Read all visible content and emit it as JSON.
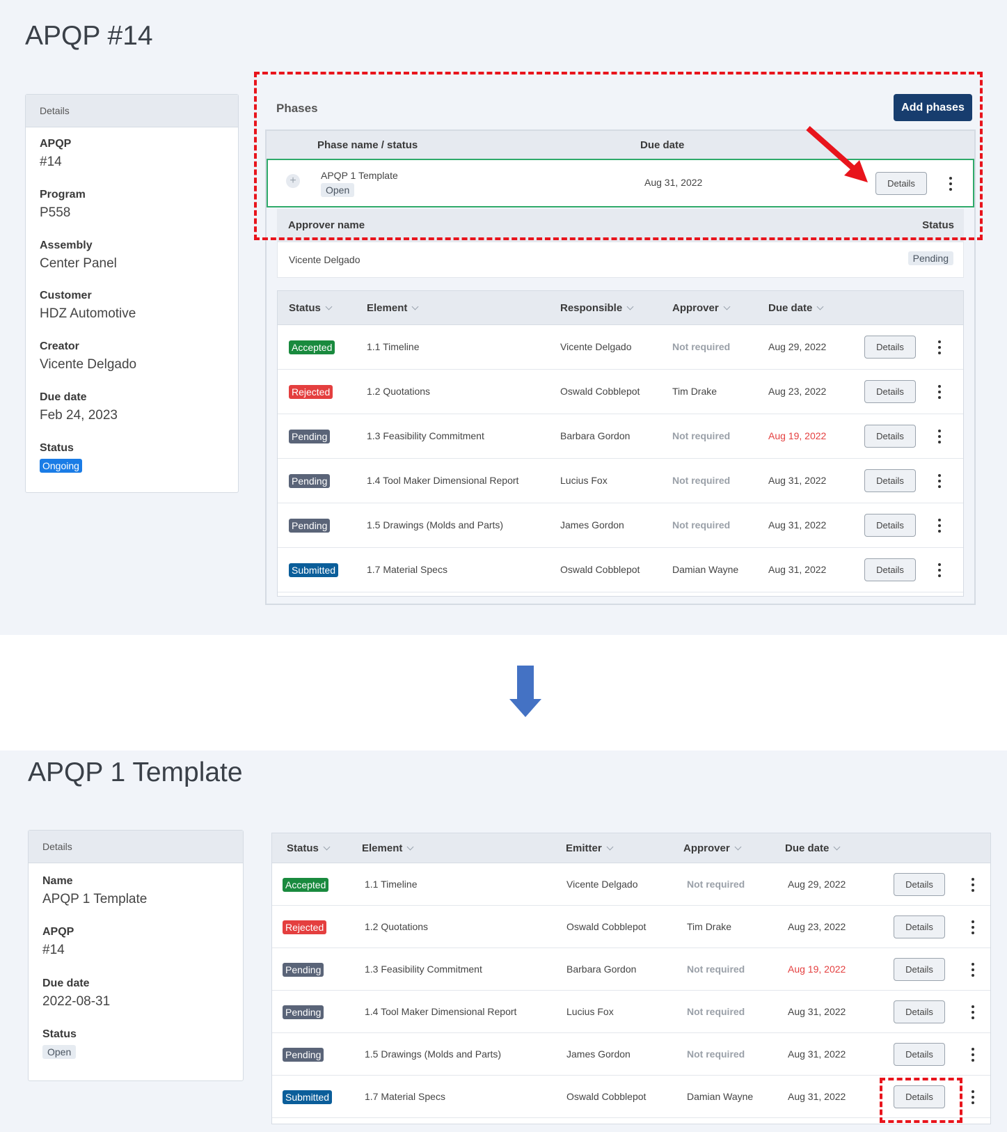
{
  "top": {
    "title": "APQP #14",
    "details": {
      "header": "Details",
      "fields": [
        {
          "label": "APQP",
          "value": "#14"
        },
        {
          "label": "Program",
          "value": "P558"
        },
        {
          "label": "Assembly",
          "value": "Center Panel"
        },
        {
          "label": "Customer",
          "value": "HDZ Automotive"
        },
        {
          "label": "Creator",
          "value": "Vicente Delgado"
        },
        {
          "label": "Due date",
          "value": "Feb 24, 2023"
        }
      ],
      "status_label": "Status",
      "status_value": "Ongoing"
    },
    "phases": {
      "title": "Phases",
      "add_button": "Add phases",
      "col_name": "Phase name / status",
      "col_due": "Due date",
      "phase_name": "APQP 1 Template",
      "phase_status": "Open",
      "phase_due": "Aug 31, 2022",
      "details_button": "Details",
      "approver_col_name": "Approver name",
      "approver_col_status": "Status",
      "approver_name": "Vicente Delgado",
      "approver_status": "Pending"
    },
    "elements": {
      "columns": [
        "Status",
        "Element",
        "Responsible",
        "Approver",
        "Due date"
      ],
      "rows": [
        {
          "status": "Accepted",
          "element": "1.1 Timeline",
          "person": "Vicente Delgado",
          "approver": "Not required",
          "due": "Aug 29, 2022",
          "details": "Details"
        },
        {
          "status": "Rejected",
          "element": "1.2 Quotations",
          "person": "Oswald Cobblepot",
          "approver": "Tim Drake",
          "due": "Aug 23, 2022",
          "details": "Details"
        },
        {
          "status": "Pending",
          "element": "1.3 Feasibility Commitment",
          "person": "Barbara Gordon",
          "approver": "Not required",
          "due": "Aug 19, 2022",
          "details": "Details"
        },
        {
          "status": "Pending",
          "element": "1.4 Tool Maker Dimensional Report",
          "person": "Lucius Fox",
          "approver": "Not required",
          "due": "Aug 31, 2022",
          "details": "Details"
        },
        {
          "status": "Pending",
          "element": "1.5 Drawings (Molds and Parts)",
          "person": "James Gordon",
          "approver": "Not required",
          "due": "Aug 31, 2022",
          "details": "Details"
        },
        {
          "status": "Submitted",
          "element": "1.7 Material Specs",
          "person": "Oswald Cobblepot",
          "approver": "Damian Wayne",
          "due": "Aug 31, 2022",
          "details": "Details"
        }
      ]
    }
  },
  "bottom": {
    "title": "APQP 1 Template",
    "details": {
      "header": "Details",
      "fields": [
        {
          "label": "Name",
          "value": "APQP 1 Template"
        },
        {
          "label": "APQP",
          "value": "#14"
        },
        {
          "label": "Due date",
          "value": "2022-08-31"
        }
      ],
      "status_label": "Status",
      "status_value": "Open"
    },
    "elements": {
      "columns": [
        "Status",
        "Element",
        "Emitter",
        "Approver",
        "Due date"
      ],
      "rows": [
        {
          "status": "Accepted",
          "element": "1.1 Timeline",
          "person": "Vicente Delgado",
          "approver": "Not required",
          "due": "Aug 29, 2022",
          "details": "Details"
        },
        {
          "status": "Rejected",
          "element": "1.2 Quotations",
          "person": "Oswald Cobblepot",
          "approver": "Tim Drake",
          "due": "Aug 23, 2022",
          "details": "Details"
        },
        {
          "status": "Pending",
          "element": "1.3 Feasibility Commitment",
          "person": "Barbara Gordon",
          "approver": "Not required",
          "due": "Aug 19, 2022",
          "details": "Details"
        },
        {
          "status": "Pending",
          "element": "1.4 Tool Maker Dimensional Report",
          "person": "Lucius Fox",
          "approver": "Not required",
          "due": "Aug 31, 2022",
          "details": "Details"
        },
        {
          "status": "Pending",
          "element": "1.5 Drawings (Molds and Parts)",
          "person": "James Gordon",
          "approver": "Not required",
          "due": "Aug 31, 2022",
          "details": "Details"
        },
        {
          "status": "Submitted",
          "element": "1.7 Material Specs",
          "person": "Oswald Cobblepot",
          "approver": "Damian Wayne",
          "due": "Aug 31, 2022",
          "details": "Details"
        }
      ]
    }
  },
  "annotation": {
    "highlight_color": "#e8141c",
    "arrow_color": "#4472c4",
    "overdue_color": "#e43f3f"
  }
}
